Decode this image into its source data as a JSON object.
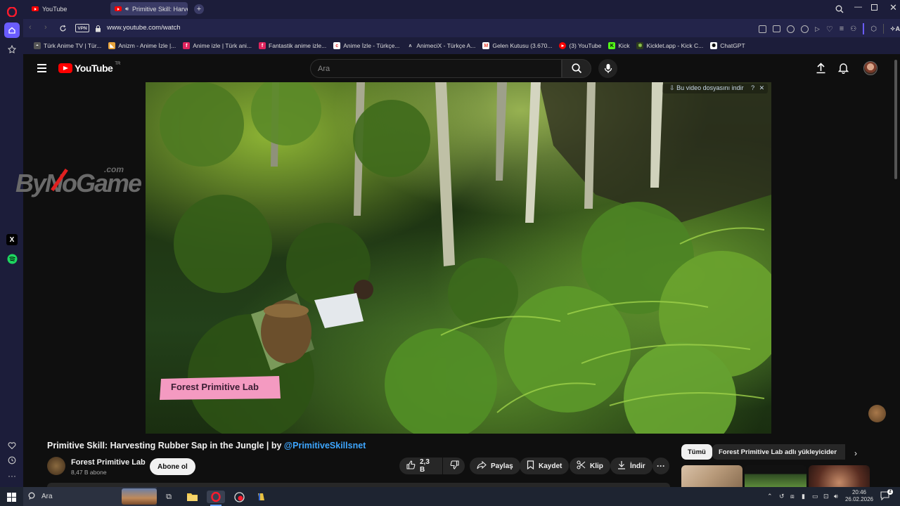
{
  "browser": {
    "tabs": [
      {
        "title": "YouTube",
        "active": false
      },
      {
        "title": "Primitive Skill: Harvest",
        "active": true
      }
    ],
    "url": "www.youtube.com/watch",
    "vpn_label": "VPN",
    "ai_label": "AI",
    "bookmarks": [
      {
        "label": "Türk Anime TV | Tür...",
        "icon": "ghost-icon",
        "color": "#9aa0a6"
      },
      {
        "label": "Anizm - Anime İzle |...",
        "icon": "anizm-icon",
        "color": "#e8a33c"
      },
      {
        "label": "Anime izle | Türk ani...",
        "icon": "f-icon",
        "color": "#e0245e"
      },
      {
        "label": "Fantastik anime izle...",
        "icon": "f-icon",
        "color": "#e0245e"
      },
      {
        "label": "Anime İzle - Türkçe...",
        "icon": "c-icon",
        "color": "#ff6b6b"
      },
      {
        "label": "AnimeciX - Türkçe A...",
        "icon": "a-icon",
        "color": "#cccccc"
      },
      {
        "label": "Gelen Kutusu (3.670...",
        "icon": "gmail-icon",
        "color": "#ea4335"
      },
      {
        "label": "(3) YouTube",
        "icon": "youtube-icon",
        "color": "#ff0000"
      },
      {
        "label": "Kick",
        "icon": "kick-icon",
        "color": "#53fc18"
      },
      {
        "label": "Kicklet.app - Kick C...",
        "icon": "kicklet-icon",
        "color": "#8bc34a"
      },
      {
        "label": "ChatGPT",
        "icon": "chatgpt-icon",
        "color": "#ffffff"
      }
    ]
  },
  "youtube": {
    "logo_text": "YouTube",
    "country": "TR",
    "search_placeholder": "Ara",
    "video": {
      "overlay_text": "Bu video dosyasını indir",
      "watermark": "Forest Primitive Lab"
    },
    "side_logo": {
      "text": "ByNoGame",
      "suffix": ".com"
    },
    "title_plain": "Primitive Skill: Harvesting Rubber Sap in the Jungle | by ",
    "title_link": "@PrimitiveSkillsnet",
    "channel": {
      "name": "Forest Primitive Lab",
      "subscribers": "8,47 B abone"
    },
    "subscribe_label": "Abone ol",
    "actions": {
      "likes": "2,3 B",
      "share": "Paylaş",
      "save": "Kaydet",
      "clip": "Klip",
      "download": "İndir"
    },
    "chips": {
      "all": "Tümü",
      "uploader": "Forest Primitive Lab adlı yükleyiciden"
    }
  },
  "taskbar": {
    "search_placeholder": "Ara",
    "time": "20:46",
    "date": "26.02.2026"
  },
  "colors": {
    "opera_red": "#ff1b2d",
    "youtube_red": "#ff0000",
    "link_blue": "#3ea6ff",
    "watermark_pink": "#f49ac1"
  }
}
